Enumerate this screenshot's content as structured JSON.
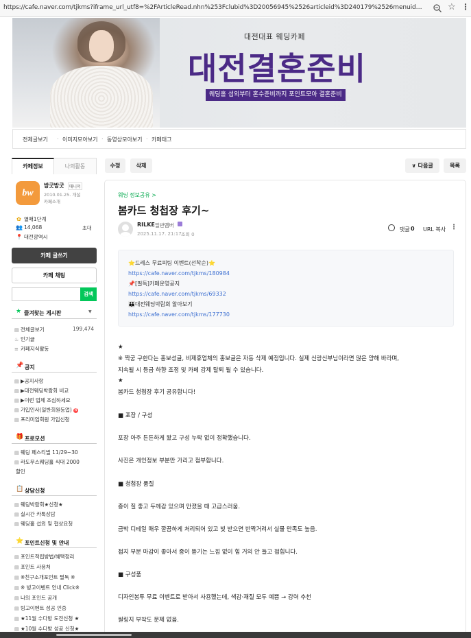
{
  "browser": {
    "url": "https://cafe.naver.com/tjkms?iframe_url_utf8=%2FArticleRead.nhn%253Fclubid%3D20056945%2526articleid%3D240179%2526menuid%3D144%2..."
  },
  "banner": {
    "subtitle": "대전대표 웨딩카페",
    "title": "대전결혼준비",
    "tagline": "웨딩홀 섭외부터 혼수준비까지 포인트모아 결혼준비",
    "accent": "#4b2a86"
  },
  "menubar": {
    "items": [
      "전체글보기",
      "이미지모아보기",
      "동영상모아보기",
      "카페태그"
    ]
  },
  "sidebar": {
    "tabs": [
      "카페정보",
      "나의활동"
    ],
    "cafe_name": "방굿방굿",
    "manager_label": "매니저",
    "since": "2010.01.25. 개설",
    "intro": "카페소개",
    "level": "열매1단계",
    "members": "14,068",
    "invite": "초대",
    "region": "대전광역시",
    "write_button": "카페 글쓰기",
    "chat_button": "카페 채팅",
    "search_button": "검색",
    "fav_title": "즐겨찾는 게시판",
    "top_links": [
      {
        "label": "전체글보기",
        "count": "199,474"
      },
      {
        "label": "인기글"
      },
      {
        "label": "카페지식활동"
      }
    ],
    "sections": [
      {
        "icon": "📌",
        "title": "공지",
        "items": [
          "▶공지사항",
          "▶대전웨딩박람회 비교",
          "▶이런 업체 조심하세요",
          "가입인사(일반회원등업)",
          "프리미엄회원 가입신청"
        ]
      },
      {
        "icon": "🎁",
        "title": "프로모션",
        "items": [
          "웨딩 페스티벌 11/29~30",
          "라도무스웨딩홀 식대 2000",
          "할인"
        ]
      },
      {
        "icon": "📋",
        "title": "상담신청",
        "items": [
          "웨딩박람회★신청★",
          "실시간 카톡상담",
          "웨딩홀 섭외 및 협상요청"
        ]
      },
      {
        "icon": "⭐",
        "title": "포인트신청 및 안내",
        "items": [
          "포인트적립방법/혜택정리",
          "포인트 사용처",
          "※친구소개포인트 필독 ※",
          "※ 빙고이벤트 안내 Click※",
          "나의 포인트 공개",
          "빙고이벤트 성공 인증",
          "★11월 수다방 도전신청 ★",
          "★10월 수다방 성공 신청★"
        ]
      }
    ],
    "brand_green": "#03c75a"
  },
  "actions": {
    "edit": "수정",
    "delete": "삭제",
    "next": "∨ 다음글",
    "list": "목록"
  },
  "article": {
    "board": "웨딩 정보공유 >",
    "title": "봄카드 청첩장 후기~",
    "author": "RILKE",
    "grade": "일반멤버",
    "date": "2025.11.17. 21:17",
    "views": "조회 0",
    "comment_label": "댓글",
    "comment_count": "0",
    "url_copy": "URL 복사",
    "notice": [
      {
        "text": "⭐드레스 무료피팅 이벤트(선착순)⭐",
        "link": "https://cafe.naver.com/tjkms/180984"
      },
      {
        "text": "📌[필독]카페운영공지",
        "link": "https://cafe.naver.com/tjkms/69332"
      },
      {
        "text": "👪대전웨딩박람회 알아보기",
        "link": "https://cafe.naver.com/tjkms/177730"
      }
    ],
    "body": [
      "★",
      "※ 짝궁 구한다는 홍보성글, 비제휴업체의 홍보글은 자동 삭제 예정입니다. 실제 신랑신부님이라면 많은 양해 바라며,",
      "지속될 시 등급 하향 조정 및 카페 강제 탈퇴 될 수 있습니다.",
      "★",
      "봄카드 청첩장 후기 공유합니다!",
      "■ 포장 / 구성",
      "포장 아주 튼튼하게 왔고 구성 누락 없이 정확했습니다.",
      "사진은 개인정보 부분만 가리고 첨부합니다.",
      "■ 청첩장 품질",
      "종이 질 좋고 두께감 있으며 만졌을 때 고급스러움.",
      "금박 디테일 매우 깔끔하게 처리되어 있고 빛 받으면 반짝거려서 실물 만족도 높음.",
      "접지 부분 마감이 좋아서 종이 뜯기는 느낌 없이 힘 거의 안 들고 접힙니다.",
      "■ 구성품",
      "디자인봉투 무료 이벤트로 받아서 사용했는데, 색감·재질 모두 예쁨 → 강력 추천",
      "씰링지 부착도 문제 없음."
    ]
  }
}
